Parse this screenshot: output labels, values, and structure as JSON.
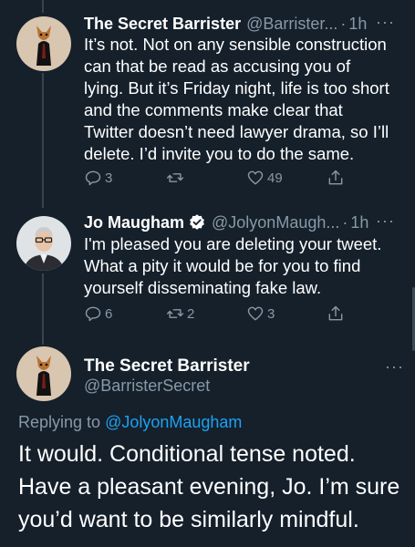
{
  "tweets": [
    {
      "name": "The Secret Barrister",
      "handle": "@Barrister...",
      "separator": "·",
      "time": "1h",
      "more": "···",
      "text": "It’s not. Not on any sensible construction\ncan that be read as accusing you of\nlying. But it’s Friday night, life is too short\nand the comments make clear that\nTwitter doesn’t need lawyer drama, so I’ll\ndelete. I’d invite you to do the same.",
      "reply_count": "3",
      "retweet_count": "",
      "like_count": "49"
    },
    {
      "name": "Jo Maugham",
      "verified": true,
      "handle": "@JolyonMaugh...",
      "separator": "·",
      "time": "1h",
      "more": "···",
      "text": "I'm pleased you are deleting your tweet.\nWhat a pity it would be for you to find\nyourself disseminating fake law.",
      "reply_count": "6",
      "retweet_count": "2",
      "like_count": "3"
    }
  ],
  "main_tweet": {
    "name": "The Secret Barrister",
    "handle": "@BarristerSecret",
    "more": "···",
    "replying_prefix": "Replying to",
    "replying_handle": "@JolyonMaugham",
    "text": "It would. Conditional tense noted.\nHave a pleasant evening, Jo. I’m sure\nyou’d want to be similarly mindful."
  },
  "colors": {
    "background": "#15202b",
    "secondary_text": "#8899a6",
    "link": "#1da1f2",
    "verified": "#ffffff"
  }
}
